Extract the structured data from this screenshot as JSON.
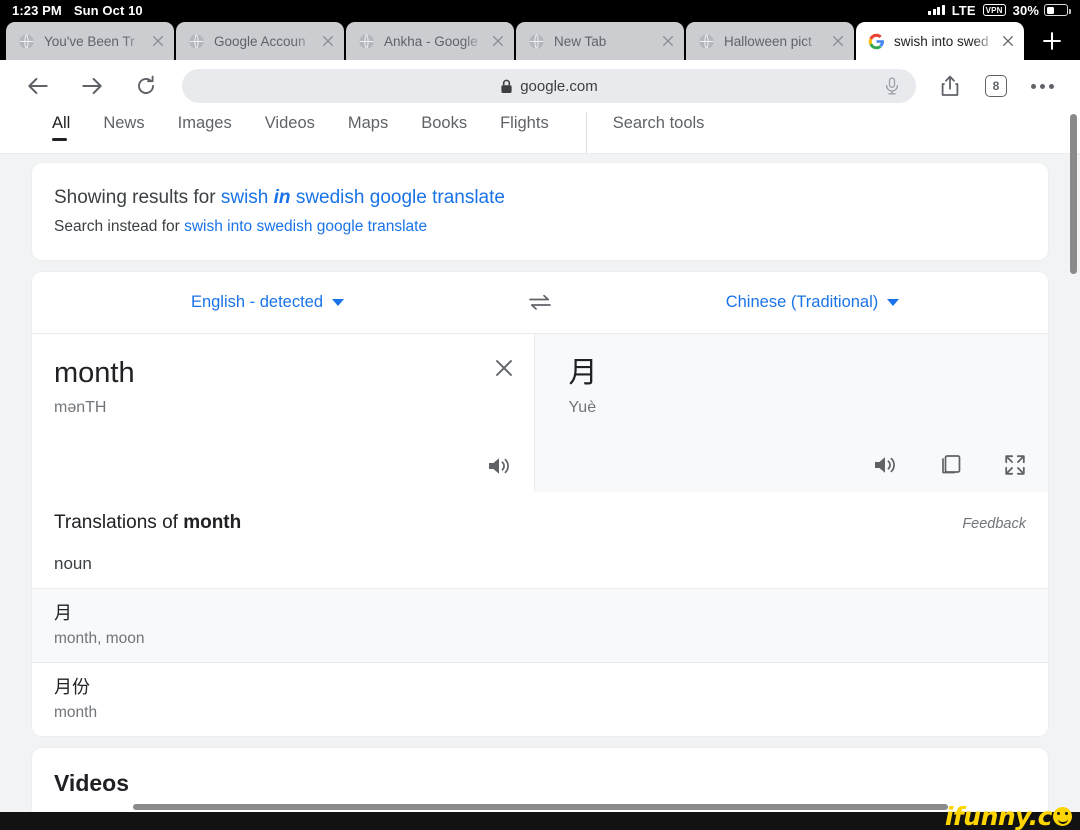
{
  "status_bar": {
    "time": "1:23 PM",
    "date": "Sun Oct 10",
    "network": "LTE",
    "vpn": "VPN",
    "battery": "30%"
  },
  "browser": {
    "tabs": [
      {
        "title": "You've Been Tr",
        "favicon": "globe-icon",
        "active": false
      },
      {
        "title": "Google Accoun",
        "favicon": "globe-icon",
        "active": false
      },
      {
        "title": "Ankha - Google",
        "favicon": "globe-icon",
        "active": false
      },
      {
        "title": "New Tab",
        "favicon": "globe-icon",
        "active": false
      },
      {
        "title": "Halloween pict",
        "favicon": "globe-icon",
        "active": false
      },
      {
        "title": "swish into swed",
        "favicon": "google-g-icon",
        "active": true
      }
    ],
    "new_tab_label": "+",
    "toolbar": {
      "back": "back-arrow",
      "forward": "forward-arrow",
      "reload": "reload-arrow",
      "url": "google.com",
      "lock": "lock-icon",
      "mic": "microphone-icon",
      "share": "share-icon",
      "tab_count": "8",
      "more": "more-dots"
    }
  },
  "search": {
    "nav": [
      {
        "label": "All",
        "active": true
      },
      {
        "label": "News",
        "active": false
      },
      {
        "label": "Images",
        "active": false
      },
      {
        "label": "Videos",
        "active": false
      },
      {
        "label": "Maps",
        "active": false
      },
      {
        "label": "Books",
        "active": false
      },
      {
        "label": "Flights",
        "active": false
      }
    ],
    "search_tools": "Search tools"
  },
  "spelling": {
    "showing_prefix": "Showing results for ",
    "showing_term_a": "swish ",
    "showing_term_em": "in",
    "showing_term_b": " swedish google translate",
    "instead_prefix": "Search instead for ",
    "instead_term": "swish into swedish google translate"
  },
  "translate": {
    "source_language": "English - detected",
    "target_language": "Chinese (Traditional)",
    "swap_icon": "swap-arrows-icon",
    "source_text": "month",
    "source_phonetic": "mənTH",
    "target_text": "月",
    "target_phonetic": "Yuè",
    "clear_icon": "close-icon",
    "listen_source_icon": "speaker-icon",
    "listen_target_icon": "speaker-icon",
    "copy_icon": "copy-icon",
    "fullscreen_icon": "fullscreen-icon"
  },
  "translations": {
    "title_prefix": "Translations of ",
    "title_term": "month",
    "feedback": "Feedback",
    "part_of_speech": "noun",
    "rows": [
      {
        "term": "月",
        "gloss": "month, moon"
      },
      {
        "term": "月份",
        "gloss": "month"
      }
    ]
  },
  "videos_section": {
    "heading": "Videos"
  },
  "watermark": {
    "text": "ifunny.c"
  },
  "colors": {
    "link": "#1a73e8",
    "text": "#202124",
    "muted": "#70757a",
    "page_bg": "#f1f3f4",
    "watermark": "#ffd500"
  }
}
